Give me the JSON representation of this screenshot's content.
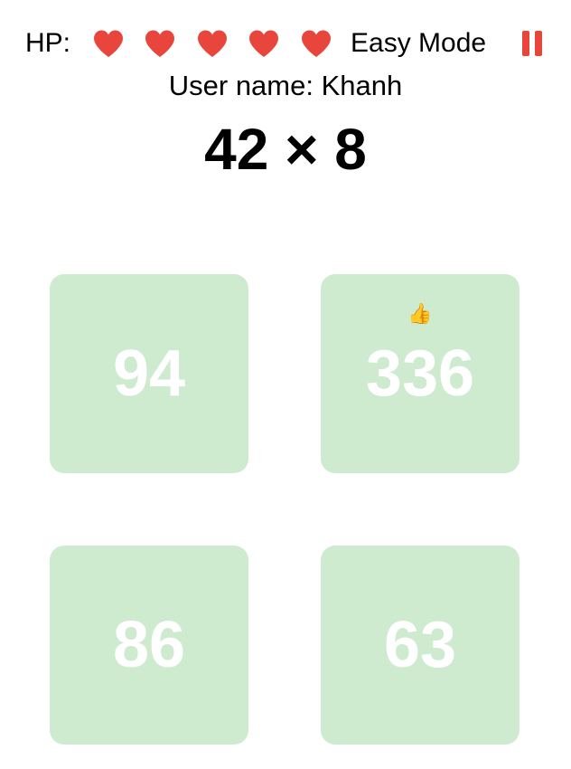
{
  "header": {
    "hp_label": "HP:",
    "hearts": [
      "heart",
      "heart",
      "heart",
      "heart",
      "heart"
    ],
    "heart_color": "#e8453c",
    "mode_label": "Easy Mode",
    "pause_icon": "pause-icon",
    "pause_color": "#e8453c"
  },
  "user": {
    "label": "User name: Khanh"
  },
  "question": {
    "text": "42 × 8"
  },
  "answers": [
    {
      "value": "94",
      "badge": ""
    },
    {
      "value": "336",
      "badge": "👍"
    },
    {
      "value": "86",
      "badge": ""
    },
    {
      "value": "63",
      "badge": ""
    }
  ],
  "colors": {
    "tile_bg": "#ceebd0",
    "tile_text": "#ffffff"
  }
}
